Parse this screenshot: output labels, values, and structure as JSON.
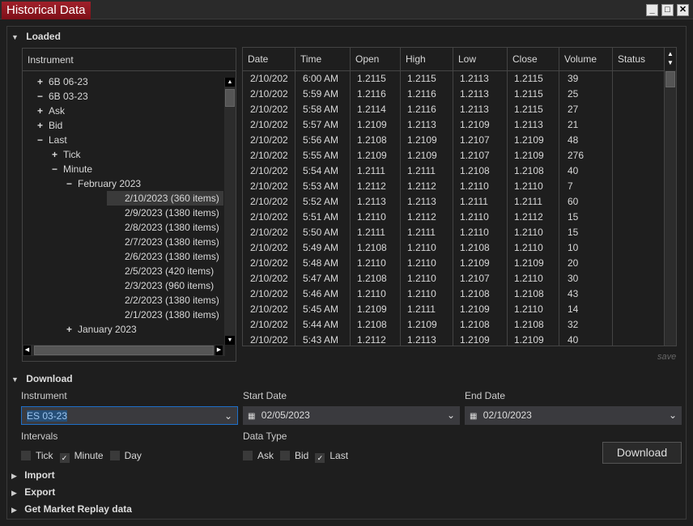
{
  "window": {
    "title": "Historical Data",
    "min": "_",
    "max": "□",
    "close": "✕"
  },
  "loaded": {
    "label": "Loaded",
    "tree_header": "Instrument",
    "tree": [
      {
        "sign": "+",
        "text": "6B 06-23",
        "level": 0
      },
      {
        "sign": "−",
        "text": "6B 03-23",
        "level": 0
      },
      {
        "sign": "+",
        "text": "Ask",
        "level": 1
      },
      {
        "sign": "+",
        "text": "Bid",
        "level": 1
      },
      {
        "sign": "−",
        "text": "Last",
        "level": 1
      },
      {
        "sign": "+",
        "text": "Tick",
        "level": 2
      },
      {
        "sign": "−",
        "text": "Minute",
        "level": 2
      },
      {
        "sign": "−",
        "text": "February 2023",
        "level": 3
      },
      {
        "sign": "",
        "text": "2/10/2023 (360 items)",
        "level": 4,
        "selected": true
      },
      {
        "sign": "",
        "text": "2/9/2023 (1380 items)",
        "level": 4
      },
      {
        "sign": "",
        "text": "2/8/2023 (1380 items)",
        "level": 4
      },
      {
        "sign": "",
        "text": "2/7/2023 (1380 items)",
        "level": 4
      },
      {
        "sign": "",
        "text": "2/6/2023 (1380 items)",
        "level": 4
      },
      {
        "sign": "",
        "text": "2/5/2023 (420 items)",
        "level": 4
      },
      {
        "sign": "",
        "text": "2/3/2023 (960 items)",
        "level": 4
      },
      {
        "sign": "",
        "text": "2/2/2023 (1380 items)",
        "level": 4
      },
      {
        "sign": "",
        "text": "2/1/2023 (1380 items)",
        "level": 4
      },
      {
        "sign": "+",
        "text": "January 2023",
        "level": 3
      }
    ],
    "columns": [
      "Date",
      "Time",
      "Open",
      "High",
      "Low",
      "Close",
      "Volume",
      "Status"
    ],
    "rows": [
      [
        "2/10/202",
        "6:00 AM",
        "1.2115",
        "1.2115",
        "1.2113",
        "1.2115",
        "39",
        ""
      ],
      [
        "2/10/202",
        "5:59 AM",
        "1.2116",
        "1.2116",
        "1.2113",
        "1.2115",
        "25",
        ""
      ],
      [
        "2/10/202",
        "5:58 AM",
        "1.2114",
        "1.2116",
        "1.2113",
        "1.2115",
        "27",
        ""
      ],
      [
        "2/10/202",
        "5:57 AM",
        "1.2109",
        "1.2113",
        "1.2109",
        "1.2113",
        "21",
        ""
      ],
      [
        "2/10/202",
        "5:56 AM",
        "1.2108",
        "1.2109",
        "1.2107",
        "1.2109",
        "48",
        ""
      ],
      [
        "2/10/202",
        "5:55 AM",
        "1.2109",
        "1.2109",
        "1.2107",
        "1.2109",
        "276",
        ""
      ],
      [
        "2/10/202",
        "5:54 AM",
        "1.2111",
        "1.2111",
        "1.2108",
        "1.2108",
        "40",
        ""
      ],
      [
        "2/10/202",
        "5:53 AM",
        "1.2112",
        "1.2112",
        "1.2110",
        "1.2110",
        "7",
        ""
      ],
      [
        "2/10/202",
        "5:52 AM",
        "1.2113",
        "1.2113",
        "1.2111",
        "1.2111",
        "60",
        ""
      ],
      [
        "2/10/202",
        "5:51 AM",
        "1.2110",
        "1.2112",
        "1.2110",
        "1.2112",
        "15",
        ""
      ],
      [
        "2/10/202",
        "5:50 AM",
        "1.2111",
        "1.2111",
        "1.2110",
        "1.2110",
        "15",
        ""
      ],
      [
        "2/10/202",
        "5:49 AM",
        "1.2108",
        "1.2110",
        "1.2108",
        "1.2110",
        "10",
        ""
      ],
      [
        "2/10/202",
        "5:48 AM",
        "1.2110",
        "1.2110",
        "1.2109",
        "1.2109",
        "20",
        ""
      ],
      [
        "2/10/202",
        "5:47 AM",
        "1.2108",
        "1.2110",
        "1.2107",
        "1.2110",
        "30",
        ""
      ],
      [
        "2/10/202",
        "5:46 AM",
        "1.2110",
        "1.2110",
        "1.2108",
        "1.2108",
        "43",
        ""
      ],
      [
        "2/10/202",
        "5:45 AM",
        "1.2109",
        "1.2111",
        "1.2109",
        "1.2110",
        "14",
        ""
      ],
      [
        "2/10/202",
        "5:44 AM",
        "1.2108",
        "1.2109",
        "1.2108",
        "1.2108",
        "32",
        ""
      ],
      [
        "2/10/202",
        "5:43 AM",
        "1.2112",
        "1.2113",
        "1.2109",
        "1.2109",
        "40",
        ""
      ]
    ],
    "save": "save"
  },
  "download": {
    "label": "Download",
    "instrument_label": "Instrument",
    "instrument": "ES 03-23",
    "start_label": "Start Date",
    "start": "02/05/2023",
    "end_label": "End Date",
    "end": "02/10/2023",
    "intervals_label": "Intervals",
    "intervals": [
      {
        "label": "Tick",
        "checked": false
      },
      {
        "label": "Minute",
        "checked": true
      },
      {
        "label": "Day",
        "checked": false
      }
    ],
    "datatype_label": "Data Type",
    "datatypes": [
      {
        "label": "Ask",
        "checked": false
      },
      {
        "label": "Bid",
        "checked": false
      },
      {
        "label": "Last",
        "checked": true
      }
    ],
    "button": "Download"
  },
  "sections": {
    "import": "Import",
    "export": "Export",
    "replay": "Get Market Replay data"
  },
  "colors": {
    "title_bg": "#8e1820",
    "accent": "#1e6fc8"
  }
}
